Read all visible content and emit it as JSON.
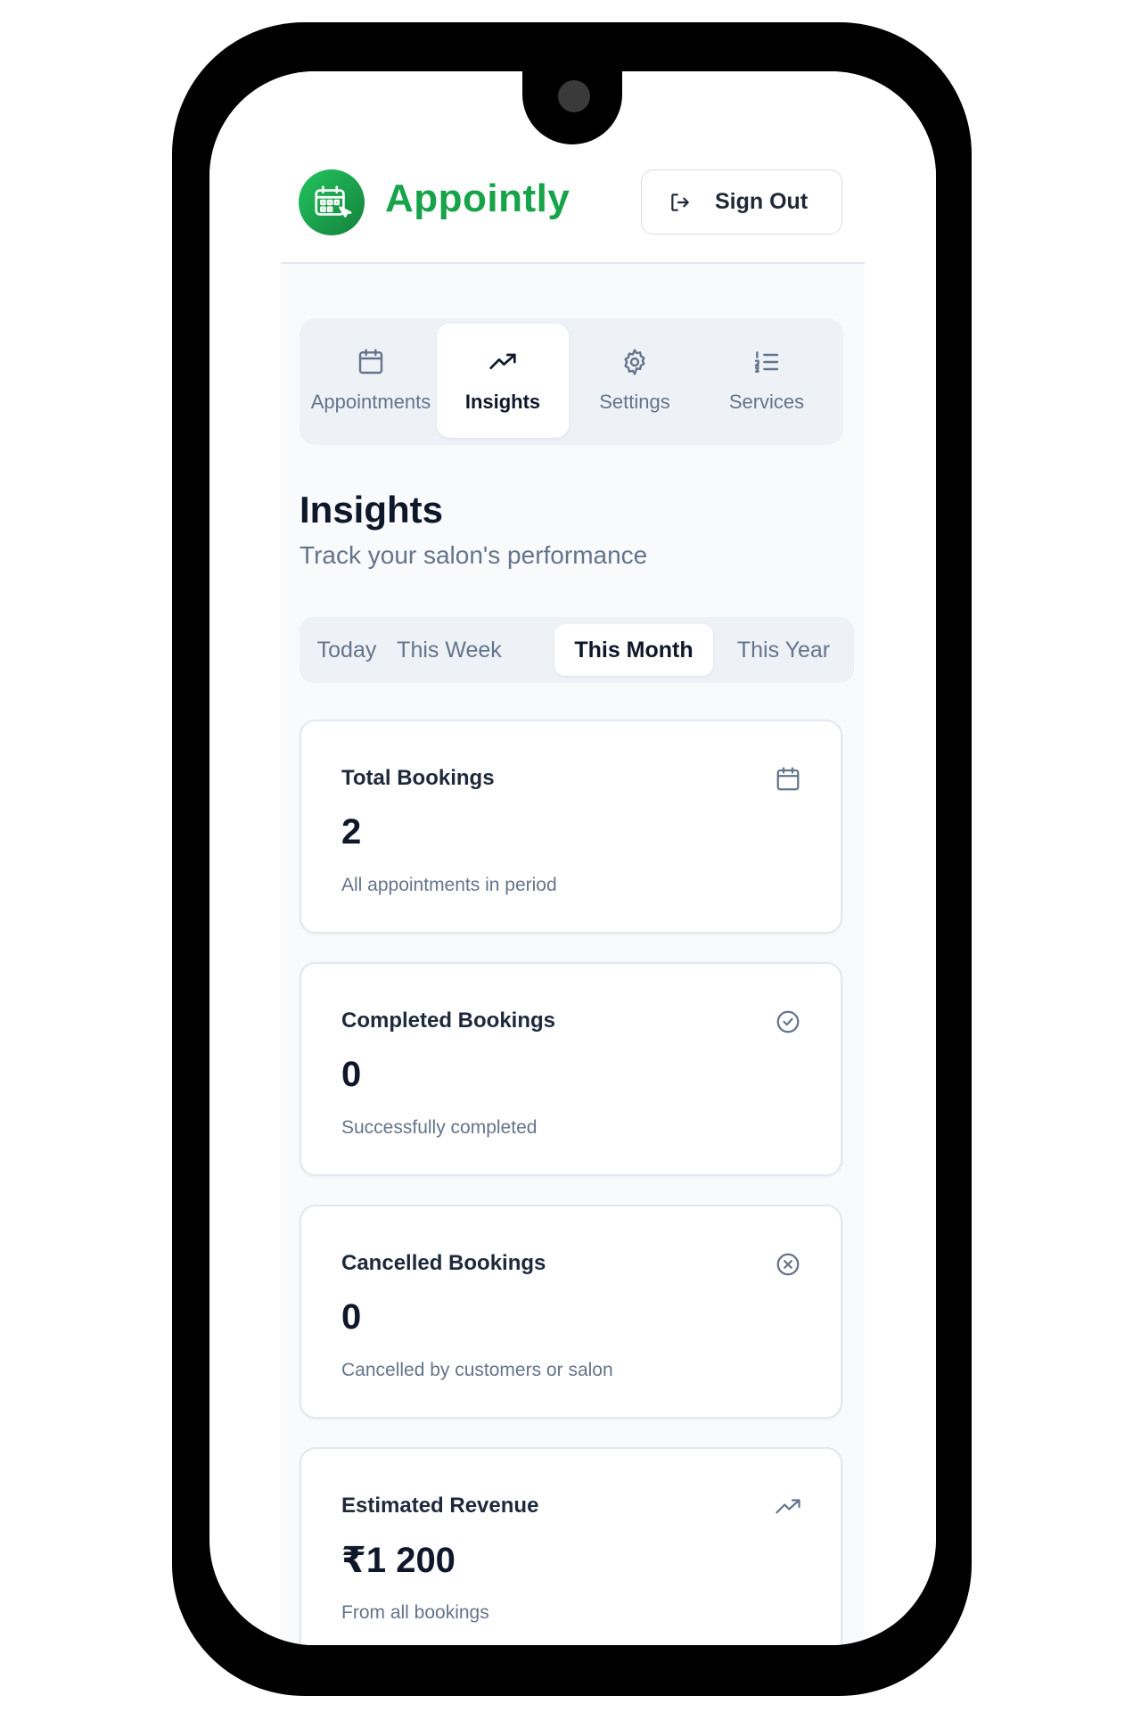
{
  "app": {
    "name": "Appointly",
    "sign_out_label": "Sign Out",
    "brand_color": "#16a34a"
  },
  "nav": {
    "tabs": [
      {
        "label": "Appointments",
        "icon": "calendar-icon",
        "active": false
      },
      {
        "label": "Insights",
        "icon": "trending-up-icon",
        "active": true
      },
      {
        "label": "Settings",
        "icon": "gear-icon",
        "active": false
      },
      {
        "label": "Services",
        "icon": "list-icon",
        "active": false
      }
    ]
  },
  "page": {
    "title": "Insights",
    "subtitle": "Track your salon's performance"
  },
  "periods": {
    "options": [
      "Today",
      "This Week",
      "This Month",
      "This Year"
    ],
    "selected": "This Month"
  },
  "stats": [
    {
      "title": "Total Bookings",
      "value": "2",
      "description": "All appointments in period",
      "icon": "calendar-icon"
    },
    {
      "title": "Completed Bookings",
      "value": "0",
      "description": "Successfully completed",
      "icon": "check-circle-icon"
    },
    {
      "title": "Cancelled Bookings",
      "value": "0",
      "description": "Cancelled by customers or salon",
      "icon": "x-circle-icon"
    },
    {
      "title": "Estimated Revenue",
      "value": "₹1 200",
      "description": "From all bookings",
      "icon": "trending-up-icon"
    }
  ]
}
